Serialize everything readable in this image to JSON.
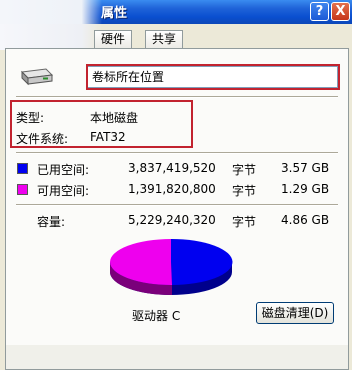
{
  "window": {
    "title": "属性",
    "help_label": "?",
    "close_label": "X"
  },
  "tabs": [
    {
      "label": "硬件"
    },
    {
      "label": "共享"
    }
  ],
  "volume": {
    "name_value": "卷标所在位置"
  },
  "info": {
    "type_label": "类型:",
    "type_value": "本地磁盘",
    "fs_label": "文件系统:",
    "fs_value": "FAT32"
  },
  "usage": {
    "used_label": "已用空间:",
    "used_bytes": "3,837,419,520",
    "used_unit": "字节",
    "used_size": "3.57 GB",
    "used_color": "#0000f0",
    "free_label": "可用空间:",
    "free_bytes": "1,391,820,800",
    "free_unit": "字节",
    "free_size": "1.29 GB",
    "free_color": "#ee00ee",
    "capacity_label": "容量:",
    "capacity_bytes": "5,229,240,320",
    "capacity_unit": "字节",
    "capacity_size": "4.86 GB"
  },
  "drive_label": "驱动器 C",
  "cleanup_button": "磁盘清理(D)"
}
